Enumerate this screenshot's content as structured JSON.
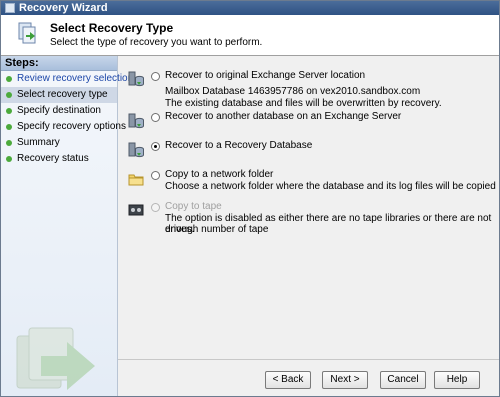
{
  "window": {
    "title": "Recovery Wizard"
  },
  "header": {
    "title": "Select Recovery Type",
    "subtitle": "Select the type of recovery you want to perform."
  },
  "sidebar": {
    "heading": "Steps:",
    "items": [
      {
        "label": "Review recovery selection"
      },
      {
        "label": "Select recovery type"
      },
      {
        "label": "Specify destination"
      },
      {
        "label": "Specify recovery options"
      },
      {
        "label": "Summary"
      },
      {
        "label": "Recovery status"
      }
    ]
  },
  "options": [
    {
      "label": "Recover to original Exchange Server location",
      "desc1": "Mailbox Database 1463957786 on vex2010.sandbox.com",
      "desc2": "The existing database and files will be overwritten by recovery.",
      "icon": "database-server-icon",
      "selected": false,
      "enabled": true
    },
    {
      "label": "Recover to another database on an Exchange Server",
      "icon": "database-server-icon",
      "selected": false,
      "enabled": true
    },
    {
      "label": "Recover to a Recovery Database",
      "icon": "database-server-icon",
      "selected": true,
      "enabled": true
    },
    {
      "label": "Copy to a network folder",
      "desc1": "Choose a network folder where the database and its log files will be copied",
      "icon": "folder-icon",
      "selected": false,
      "enabled": true
    },
    {
      "label": "Copy to tape",
      "desc1": "The option is disabled as either there are no tape libraries or there are not enough number of tape",
      "desc2": "drives.",
      "icon": "tape-icon",
      "selected": false,
      "enabled": false
    }
  ],
  "buttons": {
    "back": "< Back",
    "next": "Next >",
    "cancel": "Cancel",
    "help": "Help"
  }
}
